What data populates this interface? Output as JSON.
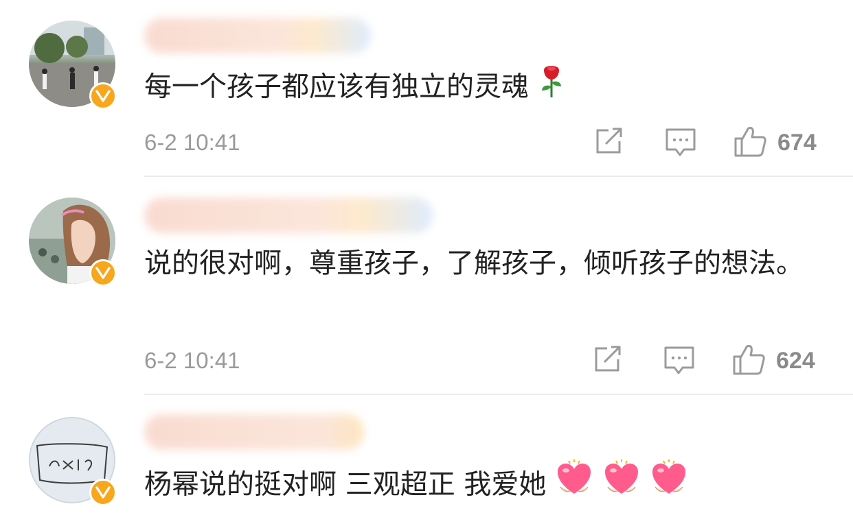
{
  "comments": [
    {
      "text": "每一个孩子都应该有独立的灵魂",
      "emoji": "rose-emoji",
      "time": "6-2 10:41",
      "likes": "674"
    },
    {
      "text": "说的很对啊，尊重孩子，了解孩子，倾听孩子的想法。",
      "time": "6-2 10:41",
      "likes": "624"
    },
    {
      "text": "杨幂说的挺对啊 三观超正 我爱她",
      "emoji": "heart-emoji",
      "emoji_count": 3
    }
  ],
  "colors": {
    "verified_badge": "#f8a61c",
    "text": "#222222",
    "meta": "#9a9a9a",
    "icon": "#9b9b9b",
    "divider": "#ececec"
  },
  "icons": [
    "share-icon",
    "reply-icon",
    "like-icon",
    "verified-icon"
  ]
}
